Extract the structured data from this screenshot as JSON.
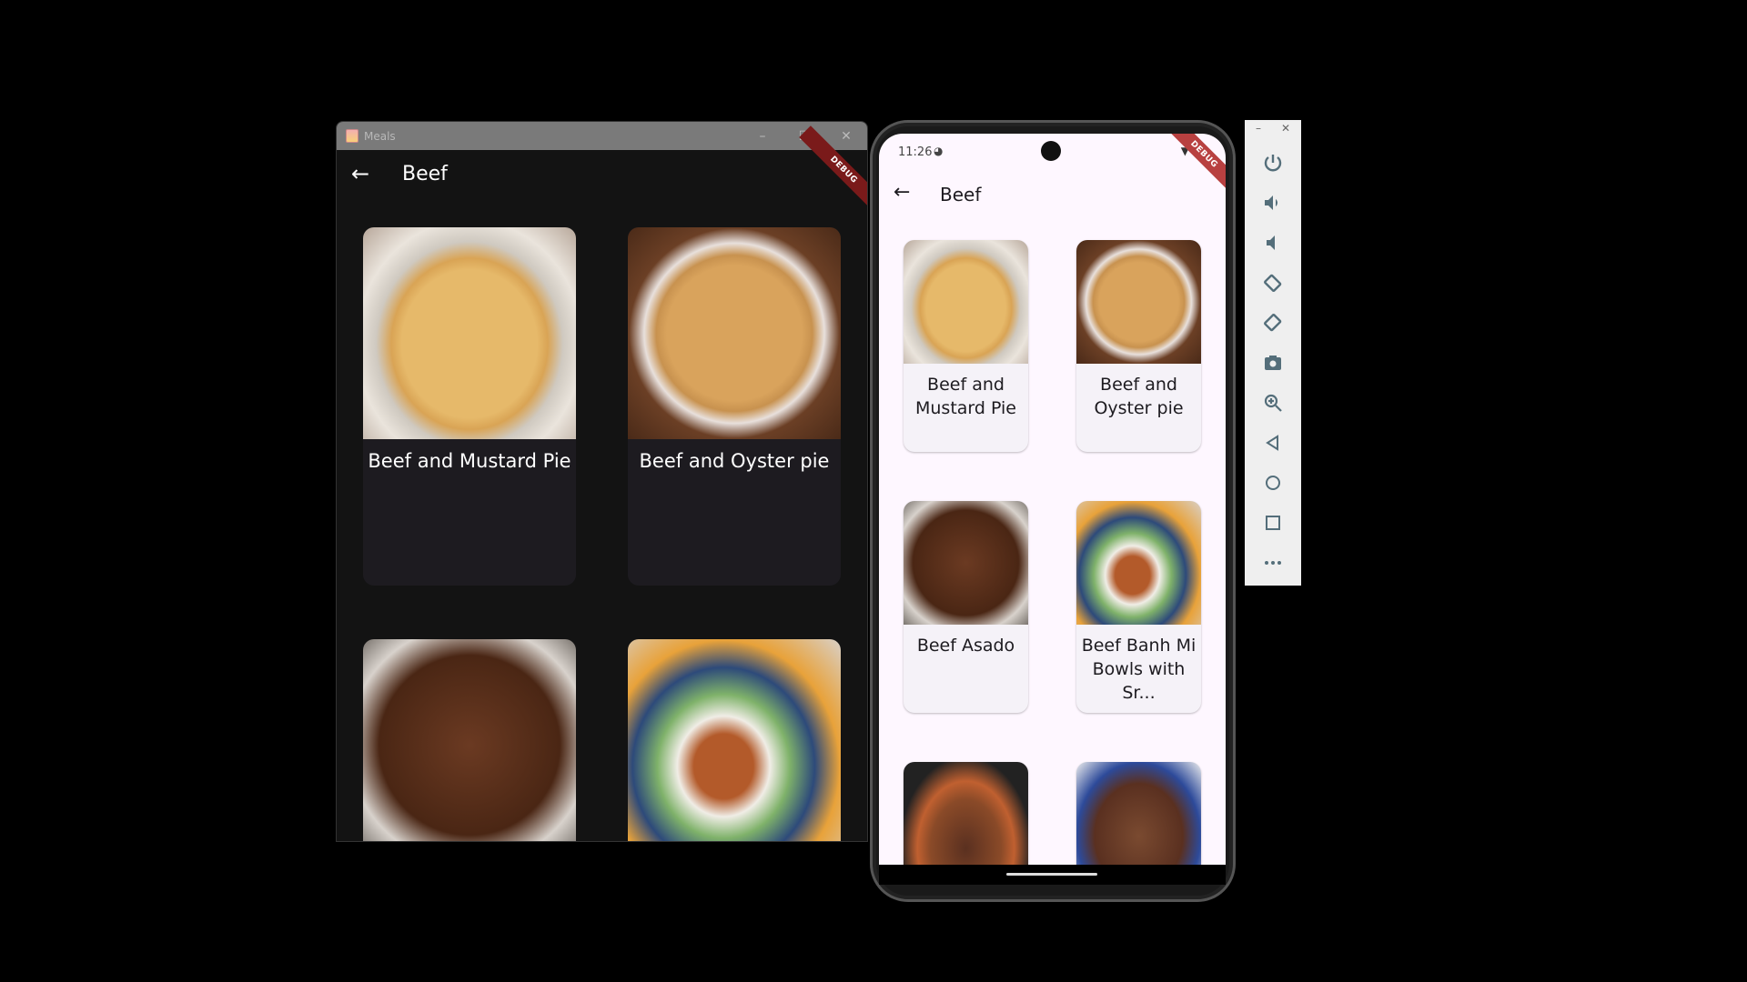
{
  "desktop_window": {
    "title": "Meals",
    "appbar_title": "Beef",
    "debug_banner": "DEBUG",
    "meals": [
      {
        "title": "Beef and Mustard Pie"
      },
      {
        "title": "Beef and Oyster pie"
      },
      {
        "title": ""
      },
      {
        "title": ""
      }
    ]
  },
  "phone": {
    "status_time": "11:26",
    "appbar_title": "Beef",
    "debug_banner": "DEBUG",
    "meals": [
      {
        "title": "Beef and Mustard Pie"
      },
      {
        "title": "Beef and Oyster pie"
      },
      {
        "title": "Beef Asado"
      },
      {
        "title": "Beef Banh Mi Bowls with Sr..."
      },
      {
        "title": ""
      },
      {
        "title": ""
      }
    ]
  },
  "emulator_toolbar": {
    "icons": [
      "power-icon",
      "volume-up-icon",
      "volume-down-icon",
      "rotate-left-icon",
      "rotate-right-icon",
      "camera-icon",
      "zoom-icon",
      "back-icon",
      "home-icon",
      "overview-icon",
      "more-icon"
    ],
    "icon_color": "#546e7a"
  }
}
